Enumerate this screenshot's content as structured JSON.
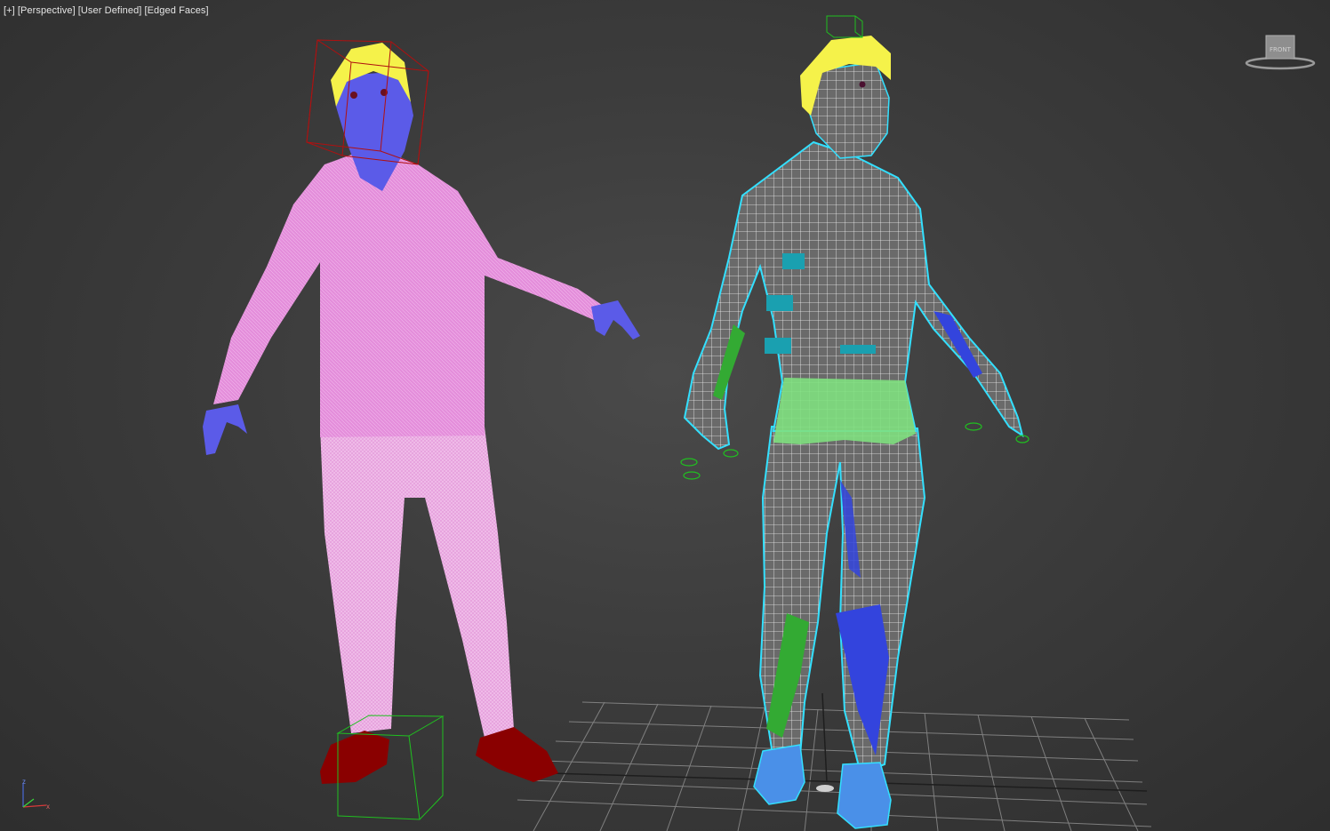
{
  "viewport": {
    "labels": [
      "[+]",
      "[Perspective]",
      "[User Defined]",
      "[Edged Faces]"
    ]
  },
  "viewcube": {
    "face_label": "FRONT"
  },
  "axis_tripod": {
    "x": "x",
    "y": "y",
    "z": "z"
  },
  "colors": {
    "background": "#3a3a3a",
    "grid": "#8a8a8a",
    "left_body": "#e58fdc",
    "left_skin": "#5b5be8",
    "left_hair": "#f5f24a",
    "left_shoes": "#8a0000",
    "right_mesh": "#dcdcdc",
    "right_outline": "#33e0ff",
    "right_shorts": "#7fe07f",
    "right_shoes": "#4a90e8",
    "bone_blue": "#3344dd",
    "bone_green": "#33aa33",
    "bone_teal": "#1aa0b0",
    "selection_red": "#b01010",
    "selection_green": "#20c020"
  }
}
